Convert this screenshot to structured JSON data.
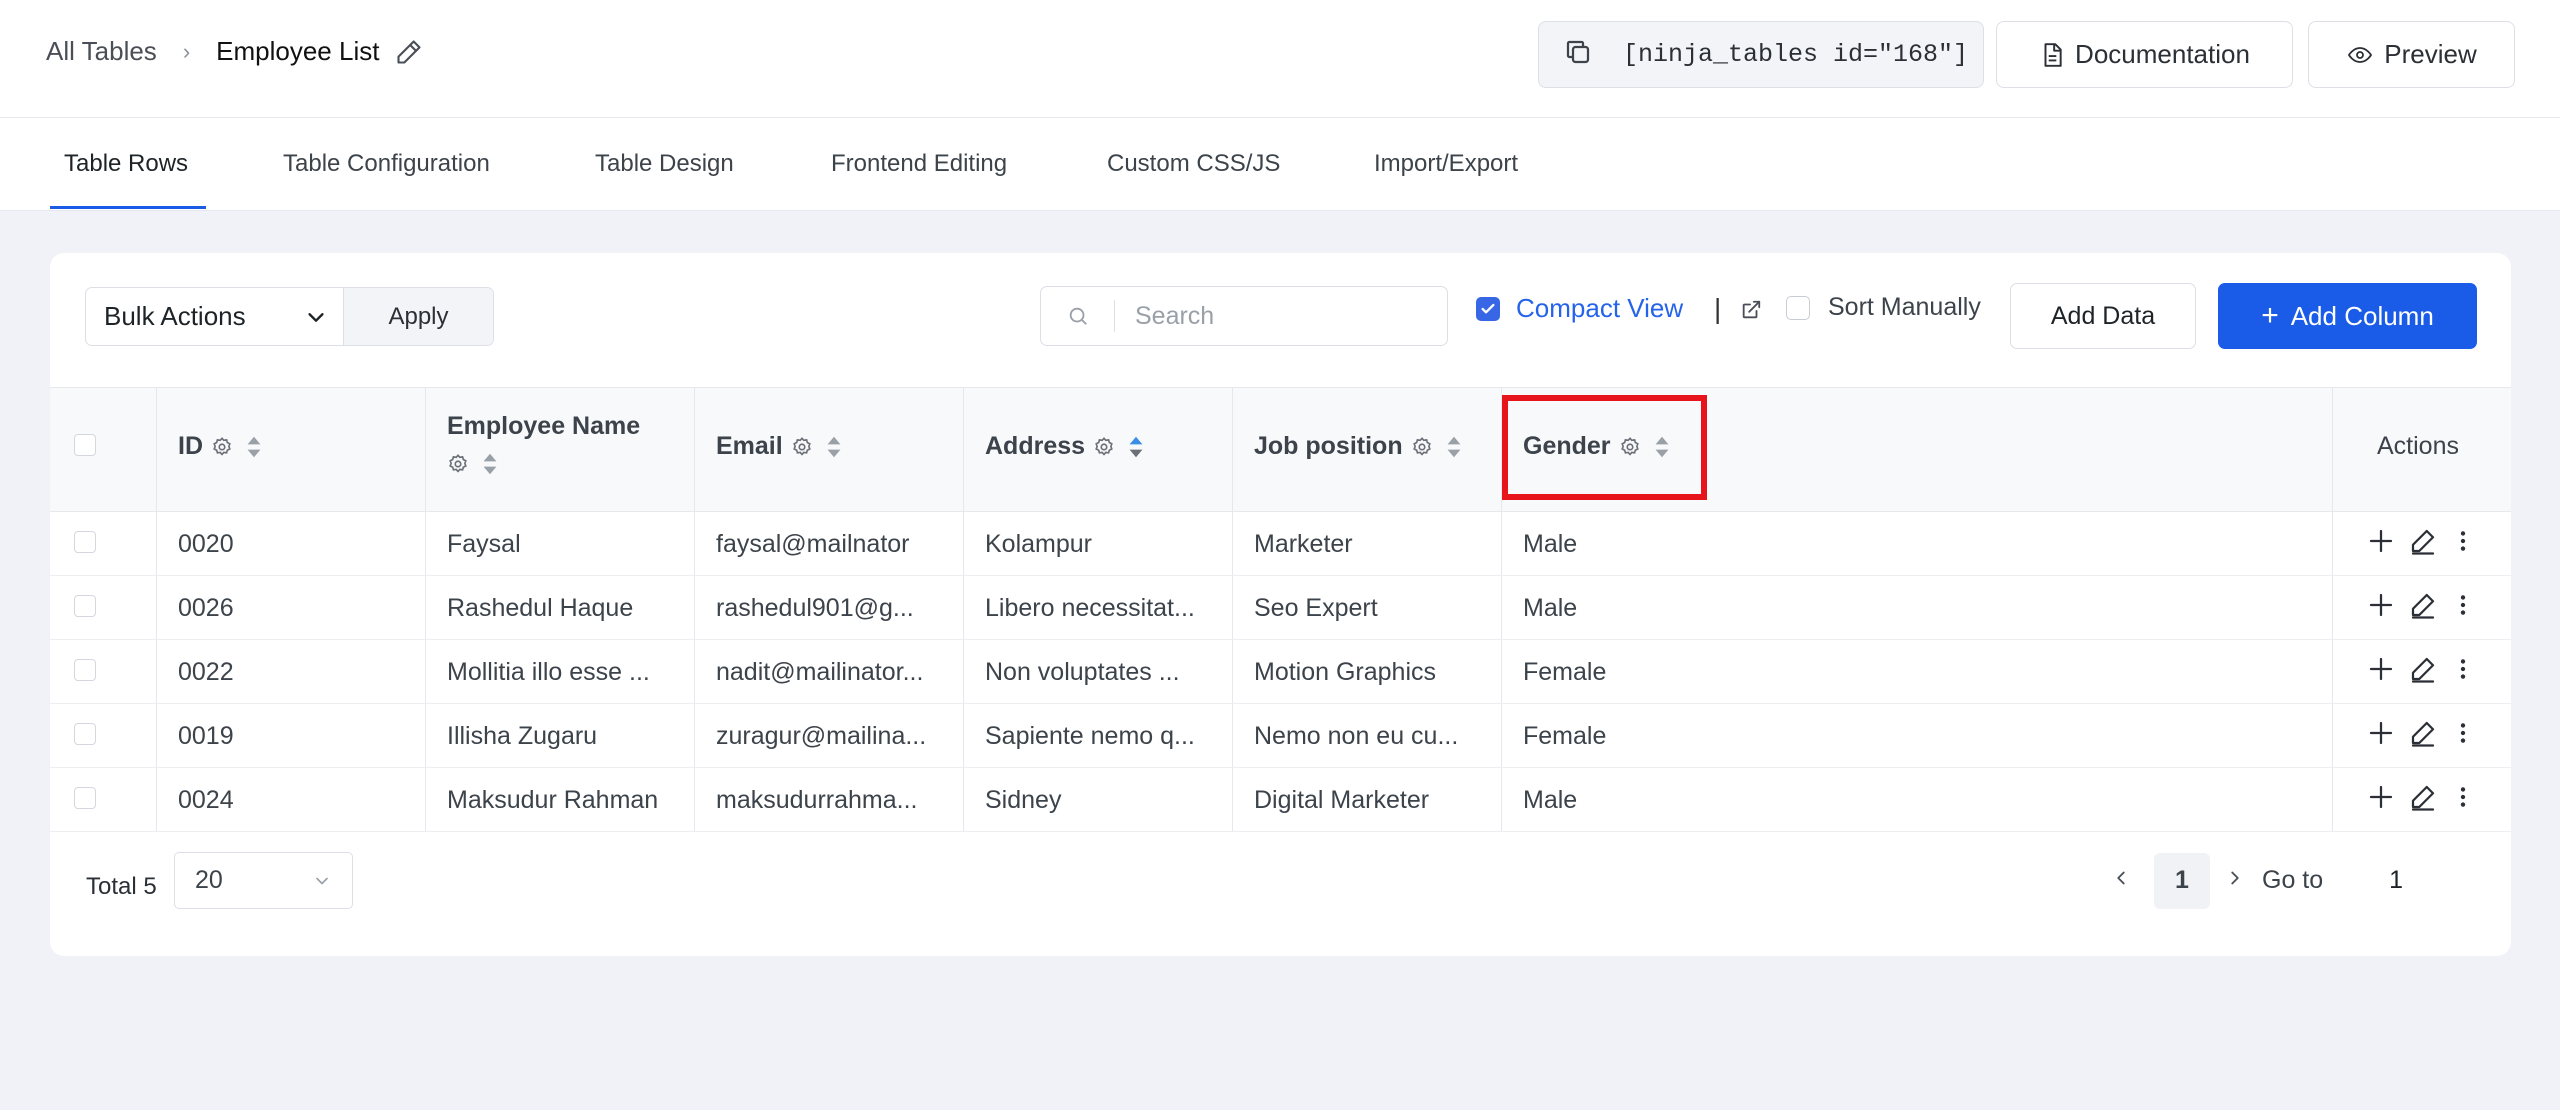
{
  "breadcrumb": {
    "root": "All Tables",
    "current": "Employee List"
  },
  "header": {
    "shortcode": "[ninja_tables id=\"168\"]",
    "documentation_label": "Documentation",
    "preview_label": "Preview"
  },
  "tabs": [
    {
      "label": "Table Rows",
      "active": true
    },
    {
      "label": "Table Configuration"
    },
    {
      "label": "Table Design"
    },
    {
      "label": "Frontend Editing"
    },
    {
      "label": "Custom CSS/JS"
    },
    {
      "label": "Import/Export"
    }
  ],
  "toolbar": {
    "bulk_actions": "Bulk Actions",
    "apply": "Apply",
    "search_placeholder": "Search",
    "compact_view": "Compact View",
    "separator": "|",
    "sort_manually": "Sort Manually",
    "add_data": "Add Data",
    "add_column": "Add Column"
  },
  "columns": {
    "id": "ID",
    "name": "Employee Name",
    "email": "Email",
    "address": "Address",
    "job": "Job position",
    "gender": "Gender",
    "actions": "Actions"
  },
  "rows": [
    {
      "id": "0020",
      "name": "Faysal",
      "email": "faysal@mailnator",
      "address": "Kolampur",
      "job": "Marketer",
      "gender": "Male"
    },
    {
      "id": "0026",
      "name": "Rashedul Haque",
      "email": "rashedul901@g...",
      "address": "Libero necessitat...",
      "job": "Seo Expert",
      "gender": "Male"
    },
    {
      "id": "0022",
      "name": "Mollitia illo esse ...",
      "email": "nadit@mailinator...",
      "address": "Non voluptates ...",
      "job": "Motion Graphics",
      "gender": "Female"
    },
    {
      "id": "0019",
      "name": "Illisha Zugaru",
      "email": "zuragur@mailina...",
      "address": "Sapiente nemo q...",
      "job": "Nemo non eu cu...",
      "gender": "Female"
    },
    {
      "id": "0024",
      "name": "Maksudur Rahman",
      "email": "maksudurrahma...",
      "address": "Sidney",
      "job": "Digital Marketer",
      "gender": "Male"
    }
  ],
  "footer": {
    "total": "Total 5",
    "page_size": "20",
    "current_page": "1",
    "goto_label": "Go to",
    "goto_value": "1"
  },
  "colors": {
    "primary": "#1a5ce8",
    "highlight": "#e8141c",
    "sort_active": "#3a8ee6"
  }
}
